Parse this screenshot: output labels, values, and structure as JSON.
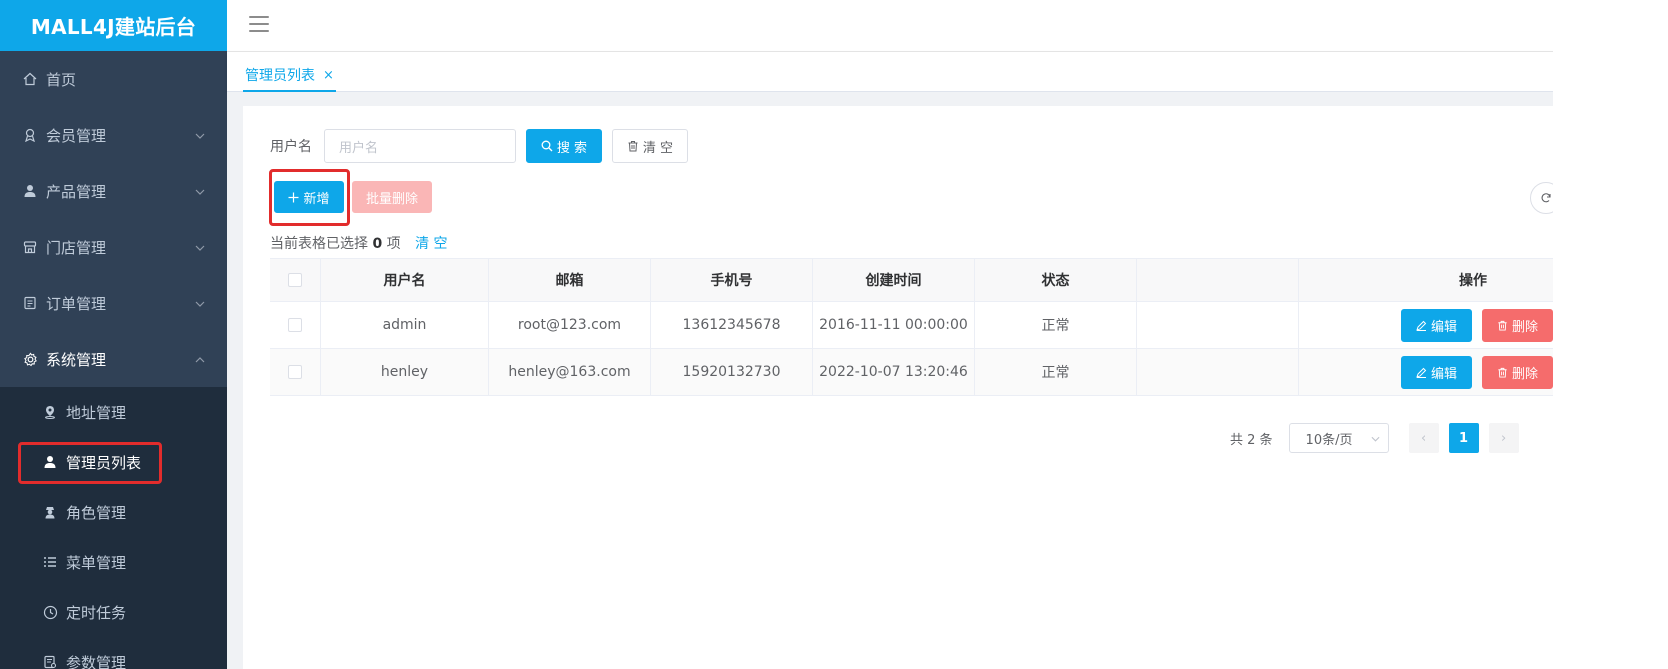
{
  "brand": {
    "title": "MALL4J建站后台"
  },
  "sidebar": {
    "items": [
      {
        "label": "首页",
        "icon": "home-icon"
      },
      {
        "label": "会员管理",
        "icon": "medal-icon"
      },
      {
        "label": "产品管理",
        "icon": "user-icon"
      },
      {
        "label": "门店管理",
        "icon": "shop-icon"
      },
      {
        "label": "订单管理",
        "icon": "document-icon"
      },
      {
        "label": "系统管理",
        "icon": "gear-icon"
      }
    ],
    "submenu": [
      {
        "label": "地址管理",
        "icon": "map-pin-icon"
      },
      {
        "label": "管理员列表",
        "icon": "user-icon"
      },
      {
        "label": "角色管理",
        "icon": "role-icon"
      },
      {
        "label": "菜单管理",
        "icon": "list-icon"
      },
      {
        "label": "定时任务",
        "icon": "clock-icon"
      },
      {
        "label": "参数管理",
        "icon": "param-icon"
      }
    ]
  },
  "tags": {
    "active_tag": "管理员列表",
    "close_glyph": "×"
  },
  "search": {
    "label": "用户名",
    "placeholder": "用户名",
    "search_button": "搜 索",
    "clear_button": "清 空"
  },
  "actions": {
    "add_button": "新增",
    "batch_delete_button": "批量删除"
  },
  "selection": {
    "prefix": "当前表格已选择",
    "count": "0",
    "suffix": "项",
    "clear_link": "清 空"
  },
  "table": {
    "headers": [
      "用户名",
      "邮箱",
      "手机号",
      "创建时间",
      "状态",
      "",
      "操作"
    ],
    "rows": [
      {
        "username": "admin",
        "email": "root@123.com",
        "phone": "13612345678",
        "created": "2016-11-11 00:00:00",
        "status": "正常"
      },
      {
        "username": "henley",
        "email": "henley@163.com",
        "phone": "15920132730",
        "created": "2022-10-07 13:20:46",
        "status": "正常"
      }
    ],
    "edit_button": "编辑",
    "delete_button": "删除"
  },
  "pagination": {
    "total": "共 2 条",
    "page_size": "10条/页",
    "current_page": "1",
    "prev_glyph": "‹",
    "next_glyph": "›"
  },
  "colors": {
    "primary": "#0ea7e9",
    "sidebar_bg": "#304156",
    "submenu_bg": "#1f2d3d",
    "danger": "#f56c6c",
    "highlight_box": "#e22c2c"
  }
}
